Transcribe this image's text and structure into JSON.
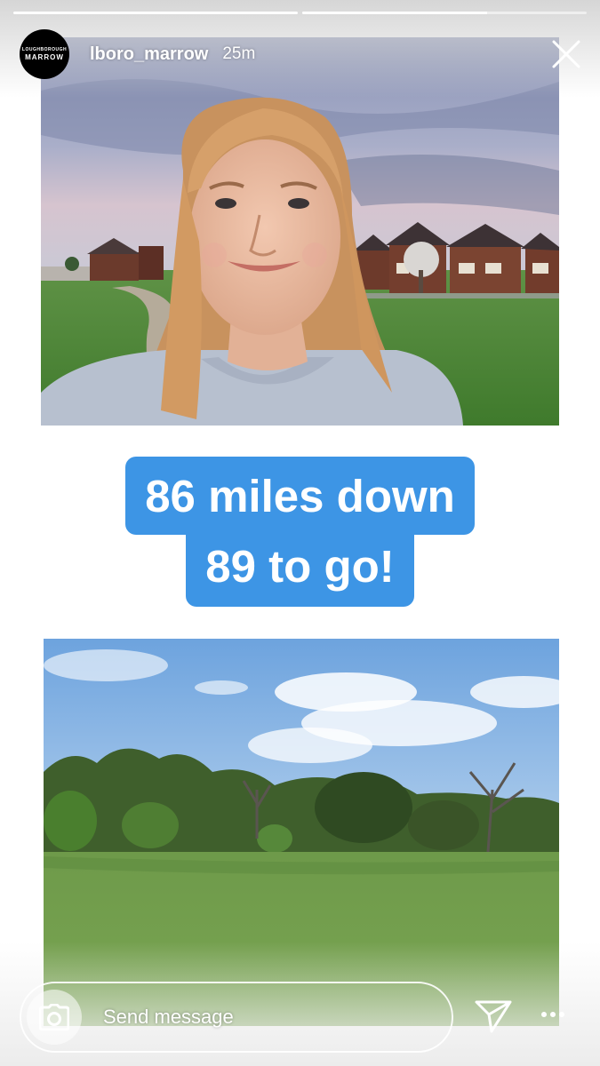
{
  "story": {
    "progress_segments": [
      {
        "label": "segment-1",
        "fill": 1.0
      },
      {
        "label": "segment-2",
        "fill": 0.65
      }
    ]
  },
  "header": {
    "avatar_line1": "LOUGHBOROUGH",
    "avatar_line2": "MARROW",
    "username": "lboro_marrow",
    "time": "25m",
    "close_icon": "close-icon"
  },
  "caption": {
    "line1": "86 miles down",
    "line2": "89 to go!",
    "background_color": "#3d95e5"
  },
  "footer": {
    "camera_icon": "camera-icon",
    "message_placeholder": "Send message",
    "send_icon": "send-icon",
    "more_icon": "more-icon"
  }
}
